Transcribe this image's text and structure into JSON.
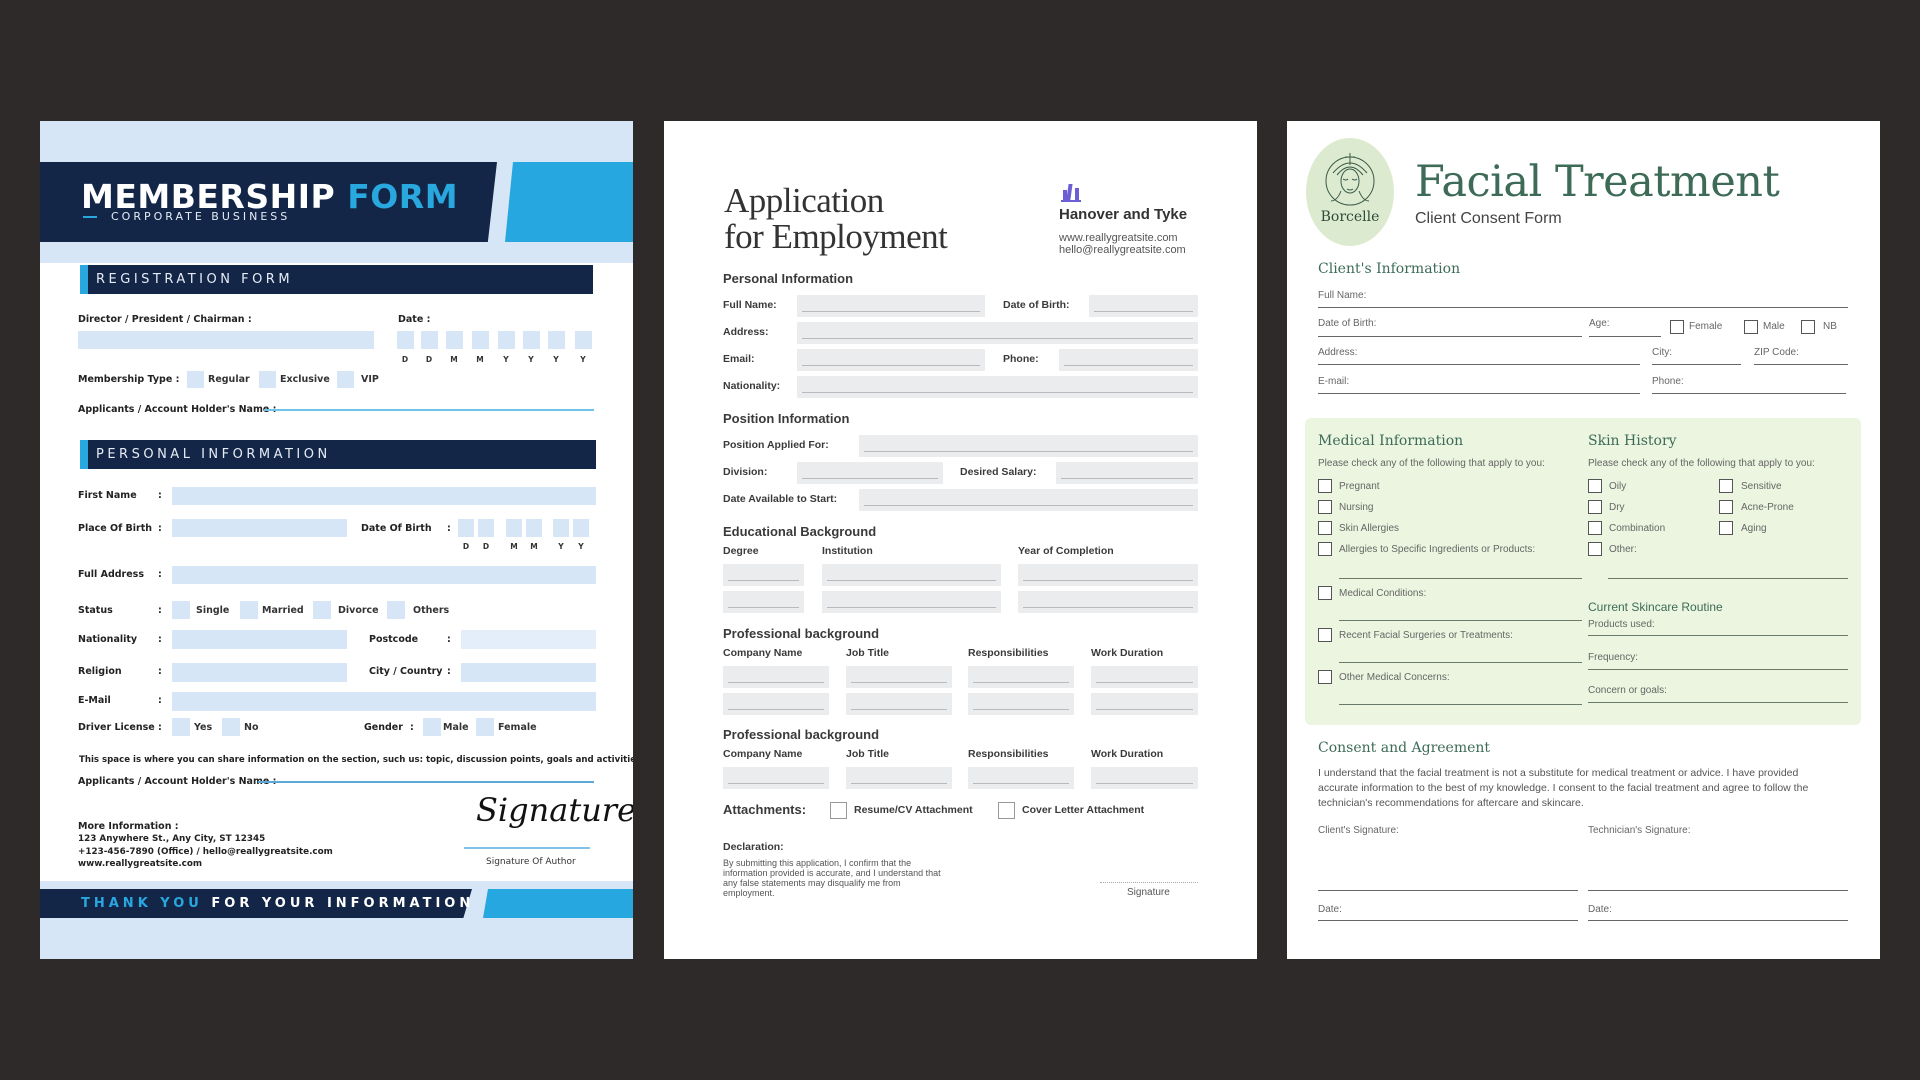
{
  "membership": {
    "title_main": "MEMBERSHIP",
    "title_accent": "FORM",
    "subtitle": "CORPORATE BUSINESS",
    "registration_heading": "REGISTRATION FORM",
    "director_label": "Director / President / Chairman :",
    "date_label": "Date :",
    "date_letters": [
      "D",
      "D",
      "M",
      "M",
      "Y",
      "Y",
      "Y",
      "Y"
    ],
    "membership_type_label": "Membership Type :",
    "membership_types": [
      "Regular",
      "Exclusive",
      "VIP"
    ],
    "applicant_label": "Applicants / Account Holder's Name :",
    "personal_heading": "PERSONAL INFORMATION",
    "colon": ":",
    "first_name_label": "First Name",
    "place_of_birth_label": "Place Of Birth",
    "dob_label": "Date Of Birth",
    "dob_letters": [
      "D",
      "D",
      "M",
      "M",
      "Y",
      "Y"
    ],
    "full_address_label": "Full Address",
    "status_label": "Status",
    "status_options": [
      "Single",
      "Married",
      "Divorce",
      "Others"
    ],
    "nationality_label": "Nationality",
    "postcode_label": "Postcode",
    "religion_label": "Religion",
    "city_country_label": "City / Country",
    "email_label": "E-Mail",
    "driver_license_label": "Driver License",
    "driver_license_options": [
      "Yes",
      "No"
    ],
    "gender_label": "Gender",
    "gender_options": [
      "Male",
      "Female"
    ],
    "note": "This space is where you can share information on the section, such us: topic, discussion points, goals and activities.",
    "applicant_label_2": "Applicants / Account Holder's Name :",
    "more_info_label": "More Information :",
    "address": "123 Anywhere St., Any City, ST 12345",
    "contact": "+123-456-7890 (Office) / hello@reallygreatsite.com",
    "website": "www.reallygreatsite.com",
    "signature_script": "Signature",
    "signature_caption": "Signature Of Author",
    "footer_accent": "THANK YOU",
    "footer_text": "FOR YOUR INFORMATION",
    "colors": {
      "navy": "#142648",
      "blue": "#27a7e0",
      "light_blue": "#d6e6f7"
    }
  },
  "application": {
    "title_line1": "Application",
    "title_line2": "for Employment",
    "company_icon": "city-buildings-icon",
    "company_name": "Hanover and Tyke",
    "company_website": "www.reallygreatsite.com",
    "company_email": "hello@reallygreatsite.com",
    "personal_heading": "Personal Information",
    "full_name_label": "Full Name:",
    "dob_label": "Date of Birth:",
    "address_label": "Address:",
    "email_label": "Email:",
    "phone_label": "Phone:",
    "nationality_label": "Nationality:",
    "position_heading": "Position Information",
    "position_label": "Position Applied For:",
    "division_label": "Division:",
    "salary_label": "Desired Salary:",
    "start_label": "Date Available to Start:",
    "education_heading": "Educational Background",
    "education_columns": [
      "Degree",
      "Institution",
      "Year of Completion"
    ],
    "professional_heading_1": "Professional background",
    "professional_heading_2": "Professional background",
    "professional_columns": [
      "Company Name",
      "Job Title",
      "Responsibilities",
      "Work Duration"
    ],
    "attachments_label": "Attachments:",
    "attachment_options": [
      "Resume/CV Attachment",
      "Cover Letter Attachment"
    ],
    "declaration_heading": "Declaration:",
    "declaration_text": "By submitting this application, I confirm that the information provided is accurate, and I understand that any false statements may disqualify me from employment.",
    "signature_label": "Signature",
    "colors": {
      "accent": "#6b5fd3",
      "field": "#ebecee"
    }
  },
  "facial": {
    "logo_text": "Borcelle",
    "logo_icon": "woman-face-icon",
    "title": "Facial Treatment",
    "subtitle": "Client Consent Form",
    "client_heading": "Client's Information",
    "full_name_label": "Full Name:",
    "dob_label": "Date of Birth:",
    "age_label": "Age:",
    "gender_options": [
      "Female",
      "Male",
      "NB"
    ],
    "address_label": "Address:",
    "city_label": "City:",
    "zip_label": "ZIP Code:",
    "email_label": "E-mail:",
    "phone_label": "Phone:",
    "medical_heading": "Medical Information",
    "medical_prompt": "Please check any of the following that apply to you:",
    "medical_options": [
      "Pregnant",
      "Nursing",
      "Skin Allergies",
      "Allergies to Specific Ingredients or Products:"
    ],
    "medical_conditions": "Medical Conditions:",
    "recent_surgeries": "Recent Facial Surgeries or Treatments:",
    "other_concerns": "Other Medical Concerns:",
    "skin_heading": "Skin History",
    "skin_prompt": "Please check any of the following that apply to you:",
    "skin_options_left": [
      "Oily",
      "Dry",
      "Combination",
      "Other:"
    ],
    "skin_options_right": [
      "Sensitive",
      "Acne-Prone",
      "Aging"
    ],
    "routine_heading": "Current Skincare Routine",
    "products_label": "Products used:",
    "frequency_label": "Frequency:",
    "concern_label": "Concern or goals:",
    "consent_heading": "Consent and Agreement",
    "consent_text": "I understand that the facial treatment is not a substitute for medical treatment or advice. I have provided accurate information to the best of my knowledge. I consent to the facial treatment and agree to follow the technician's recommendations for aftercare and skincare.",
    "client_signature_label": "Client's Signature:",
    "technician_signature_label": "Technician's Signature:",
    "date_label_1": "Date:",
    "date_label_2": "Date:",
    "colors": {
      "green_dark": "#3d6b58",
      "green_light": "#ebf5df",
      "logo_bg": "#dcebcf"
    }
  }
}
